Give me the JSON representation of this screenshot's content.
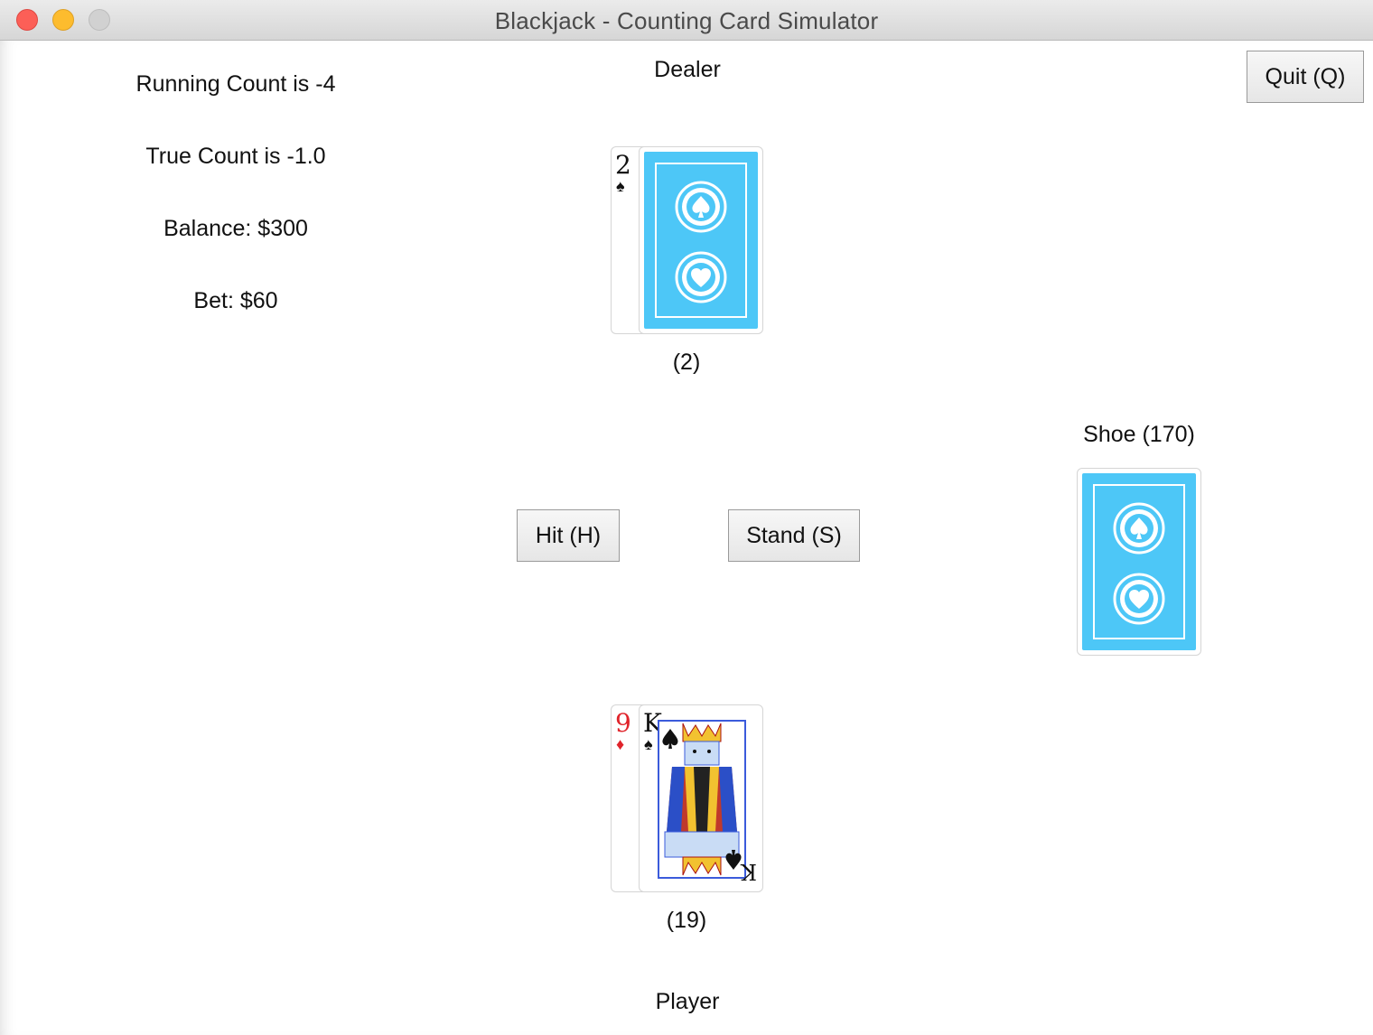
{
  "window": {
    "title": "Blackjack - Counting Card Simulator"
  },
  "stats": {
    "running_count": "Running Count is -4",
    "true_count": "True Count is -1.0",
    "balance": "Balance: $300",
    "bet": "Bet: $60"
  },
  "dealer": {
    "label": "Dealer",
    "total": "(2)",
    "cards": [
      {
        "rank": "2",
        "suit": "♠",
        "face": "up"
      },
      {
        "face": "down"
      }
    ]
  },
  "player": {
    "label": "Player",
    "total": "(19)",
    "cards": [
      {
        "rank": "9",
        "suit": "♦"
      },
      {
        "rank": "K",
        "suit": "♠"
      }
    ]
  },
  "shoe": {
    "label": "Shoe (170)"
  },
  "buttons": {
    "hit": "Hit (H)",
    "stand": "Stand (S)",
    "quit": "Quit (Q)"
  },
  "colors": {
    "card_back": "#4dc7f7",
    "red_suit": "#e0242b",
    "black_suit": "#111111"
  }
}
